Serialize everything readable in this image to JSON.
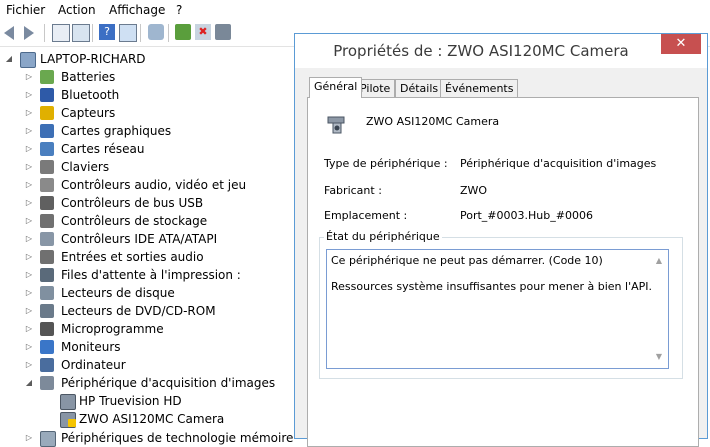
{
  "menu": [
    "Fichier",
    "Action",
    "Affichage",
    "?"
  ],
  "tree": {
    "root": "LAPTOP-RICHARD",
    "categories": [
      {
        "label": "Batteries",
        "icon": "battery-icon"
      },
      {
        "label": "Bluetooth",
        "icon": "bluetooth-icon"
      },
      {
        "label": "Capteurs",
        "icon": "sensor-icon"
      },
      {
        "label": "Cartes graphiques",
        "icon": "display-adapter-icon"
      },
      {
        "label": "Cartes réseau",
        "icon": "network-adapter-icon"
      },
      {
        "label": "Claviers",
        "icon": "keyboard-icon"
      },
      {
        "label": "Contrôleurs audio, vidéo et jeu",
        "icon": "audio-icon"
      },
      {
        "label": "Contrôleurs de bus USB",
        "icon": "usb-icon"
      },
      {
        "label": "Contrôleurs de stockage",
        "icon": "storage-controller-icon"
      },
      {
        "label": "Contrôleurs IDE ATA/ATAPI",
        "icon": "ide-icon"
      },
      {
        "label": "Entrées et sorties audio",
        "icon": "speaker-icon"
      },
      {
        "label": "Files d'attente à l'impression :",
        "icon": "printer-icon"
      },
      {
        "label": "Lecteurs de disque",
        "icon": "disk-drive-icon"
      },
      {
        "label": "Lecteurs de DVD/CD-ROM",
        "icon": "dvd-icon"
      },
      {
        "label": "Microprogramme",
        "icon": "firmware-icon"
      },
      {
        "label": "Moniteurs",
        "icon": "monitor-icon"
      },
      {
        "label": "Ordinateur",
        "icon": "computer-icon"
      },
      {
        "label": "Périphérique d'acquisition d'images",
        "icon": "camera-icon",
        "expanded": true
      }
    ],
    "children": [
      {
        "label": "HP Truevision HD",
        "icon": "webcam-icon"
      },
      {
        "label": "ZWO ASI120MC Camera",
        "icon": "webcam-warning-icon"
      }
    ],
    "partial": "Périphériques de technologie mémoire"
  },
  "dialog": {
    "title": "Propriétés de : ZWO ASI120MC Camera",
    "close": "✕",
    "tabs": [
      "Général",
      "Pilote",
      "Détails",
      "Événements"
    ],
    "device_name": "ZWO ASI120MC Camera",
    "props": [
      {
        "label": "Type de périphérique :",
        "value": "Périphérique d'acquisition d'images"
      },
      {
        "label": "Fabricant :",
        "value": "ZWO"
      },
      {
        "label": "Emplacement :",
        "value": "Port_#0003.Hub_#0006"
      }
    ],
    "status_title": "État du périphérique",
    "status_lines": [
      "Ce périphérique ne peut pas démarrer. (Code 10)",
      "Ressources système insuffisantes pour mener à bien l'API."
    ]
  }
}
